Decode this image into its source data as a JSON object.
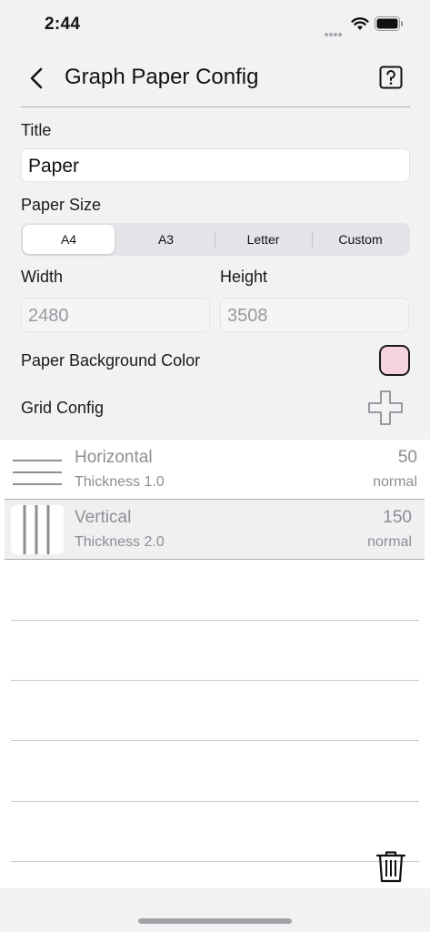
{
  "status": {
    "time": "2:44"
  },
  "nav": {
    "title": "Graph Paper Config"
  },
  "form": {
    "title_label": "Title",
    "title_value": "Paper",
    "paper_size_label": "Paper Size",
    "paper_sizes": [
      "A4",
      "A3",
      "Letter",
      "Custom"
    ],
    "selected_size": "A4",
    "width_label": "Width",
    "width_value": "2480",
    "height_label": "Height",
    "height_value": "3508",
    "bg_color_label": "Paper Background Color",
    "bg_color": "#f7d3de",
    "grid_config_label": "Grid Config"
  },
  "grid_items": [
    {
      "name": "Horizontal",
      "thickness": "Thickness 1.0",
      "value": "50",
      "style": "normal",
      "icon": "horizontal-lines-icon"
    },
    {
      "name": "Vertical",
      "thickness": "Thickness 2.0",
      "value": "150",
      "style": "normal",
      "icon": "vertical-lines-icon"
    }
  ],
  "colors": {
    "accent_text": "#111111",
    "secondary_text": "#8e8e93",
    "background": "#f2f2f4"
  }
}
